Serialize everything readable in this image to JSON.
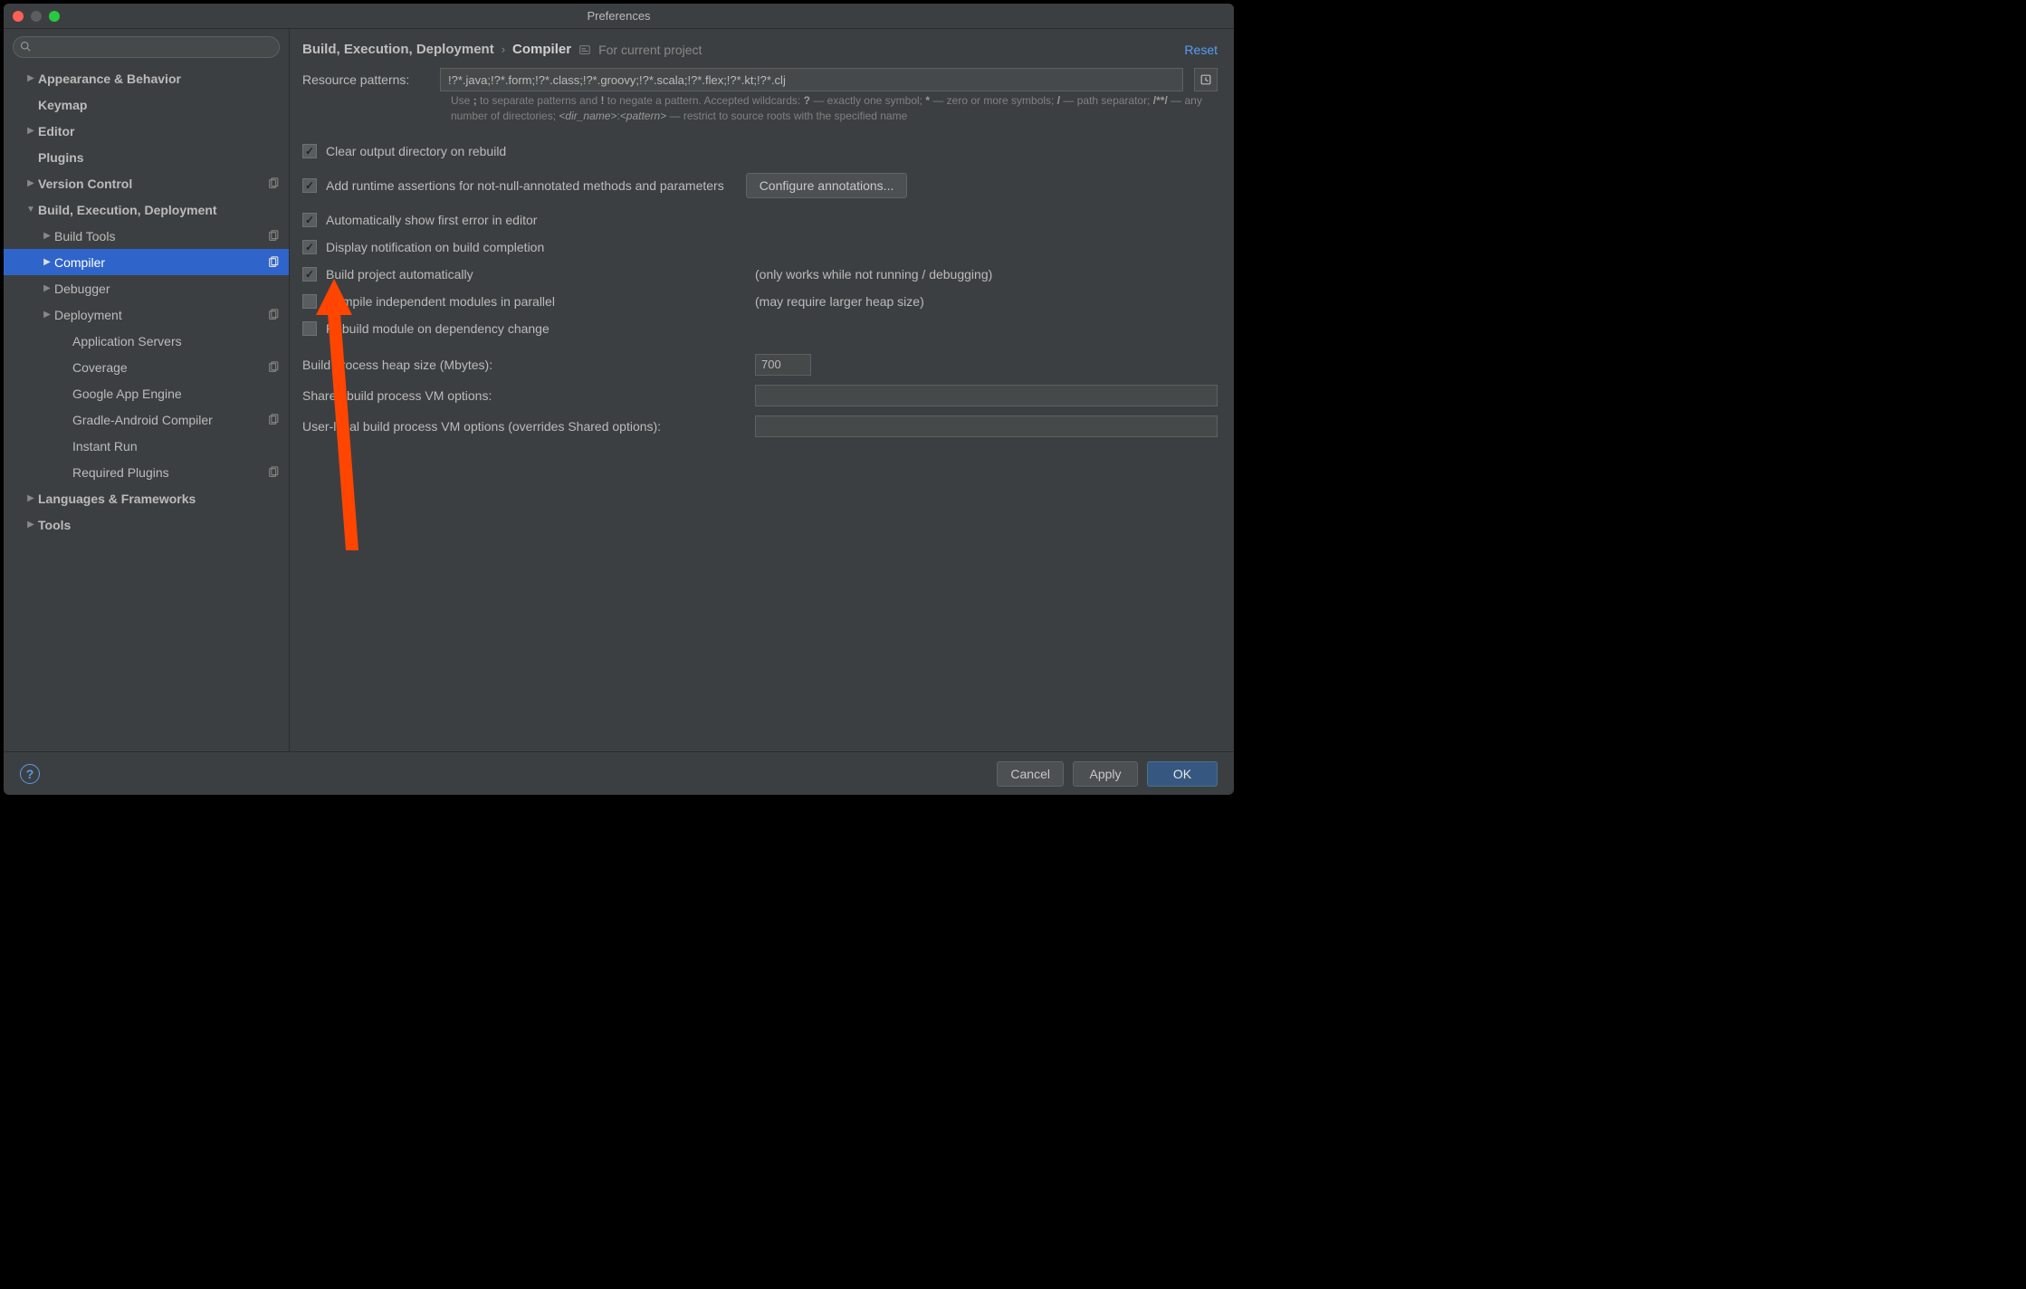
{
  "window": {
    "title": "Preferences"
  },
  "sidebar": {
    "search_placeholder": "",
    "items": [
      {
        "label": "Appearance & Behavior",
        "bold": true,
        "arrow": "right",
        "indent": 0
      },
      {
        "label": "Keymap",
        "bold": true,
        "indent": 0
      },
      {
        "label": "Editor",
        "bold": true,
        "arrow": "right",
        "indent": 0
      },
      {
        "label": "Plugins",
        "bold": true,
        "indent": 0
      },
      {
        "label": "Version Control",
        "bold": true,
        "arrow": "right",
        "indent": 0,
        "copy": true
      },
      {
        "label": "Build, Execution, Deployment",
        "bold": true,
        "arrow": "down",
        "indent": 0
      },
      {
        "label": "Build Tools",
        "arrow": "right",
        "indent": 1,
        "copy": true
      },
      {
        "label": "Compiler",
        "arrow": "right",
        "indent": 1,
        "copy": true,
        "selected": true
      },
      {
        "label": "Debugger",
        "arrow": "right",
        "indent": 1
      },
      {
        "label": "Deployment",
        "arrow": "right",
        "indent": 1,
        "copy": true
      },
      {
        "label": "Application Servers",
        "indent": 2
      },
      {
        "label": "Coverage",
        "indent": 2,
        "copy": true
      },
      {
        "label": "Google App Engine",
        "indent": 2
      },
      {
        "label": "Gradle-Android Compiler",
        "indent": 2,
        "copy": true
      },
      {
        "label": "Instant Run",
        "indent": 2
      },
      {
        "label": "Required Plugins",
        "indent": 2,
        "copy": true
      },
      {
        "label": "Languages & Frameworks",
        "bold": true,
        "arrow": "right",
        "indent": 0
      },
      {
        "label": "Tools",
        "bold": true,
        "arrow": "right",
        "indent": 0
      }
    ]
  },
  "breadcrumb": {
    "parent": "Build, Execution, Deployment",
    "sep": "›",
    "current": "Compiler",
    "scope": "For current project",
    "reset": "Reset"
  },
  "resource": {
    "label": "Resource patterns:",
    "value": "!?*.java;!?*.form;!?*.class;!?*.groovy;!?*.scala;!?*.flex;!?*.kt;!?*.clj",
    "hint_plain_1": "Use ",
    "hint_b_semi": ";",
    "hint_plain_2": " to separate patterns and ",
    "hint_b_bang": "!",
    "hint_plain_3": " to negate a pattern. Accepted wildcards: ",
    "hint_b_q": "?",
    "hint_plain_4": " — exactly one symbol; ",
    "hint_b_star": "*",
    "hint_plain_5": " — zero or more symbols; ",
    "hint_b_slash": "/",
    "hint_plain_6": " — path separator; ",
    "hint_b_dstar": "/**/",
    "hint_plain_7": " — any number of directories; ",
    "hint_i_dir": "<dir_name>",
    "hint_plain_8": ":",
    "hint_i_pat": "<pattern>",
    "hint_plain_9": " — restrict to source roots with the specified name"
  },
  "checks": {
    "clear_output": "Clear output directory on rebuild",
    "add_runtime": "Add runtime assertions for not-null-annotated methods and parameters",
    "configure_btn": "Configure annotations...",
    "auto_show_error": "Automatically show first error in editor",
    "display_notif": "Display notification on build completion",
    "build_auto": "Build project automatically",
    "build_auto_note": "(only works while not running / debugging)",
    "compile_parallel": "Compile independent modules in parallel",
    "compile_parallel_note": "(may require larger heap size)",
    "rebuild_dep": "Rebuild module on dependency change"
  },
  "form": {
    "heap_label": "Build process heap size (Mbytes):",
    "heap_value": "700",
    "shared_label": "Shared build process VM options:",
    "shared_value": "",
    "user_label": "User-local build process VM options (overrides Shared options):",
    "user_value": ""
  },
  "footer": {
    "cancel": "Cancel",
    "apply": "Apply",
    "ok": "OK"
  }
}
